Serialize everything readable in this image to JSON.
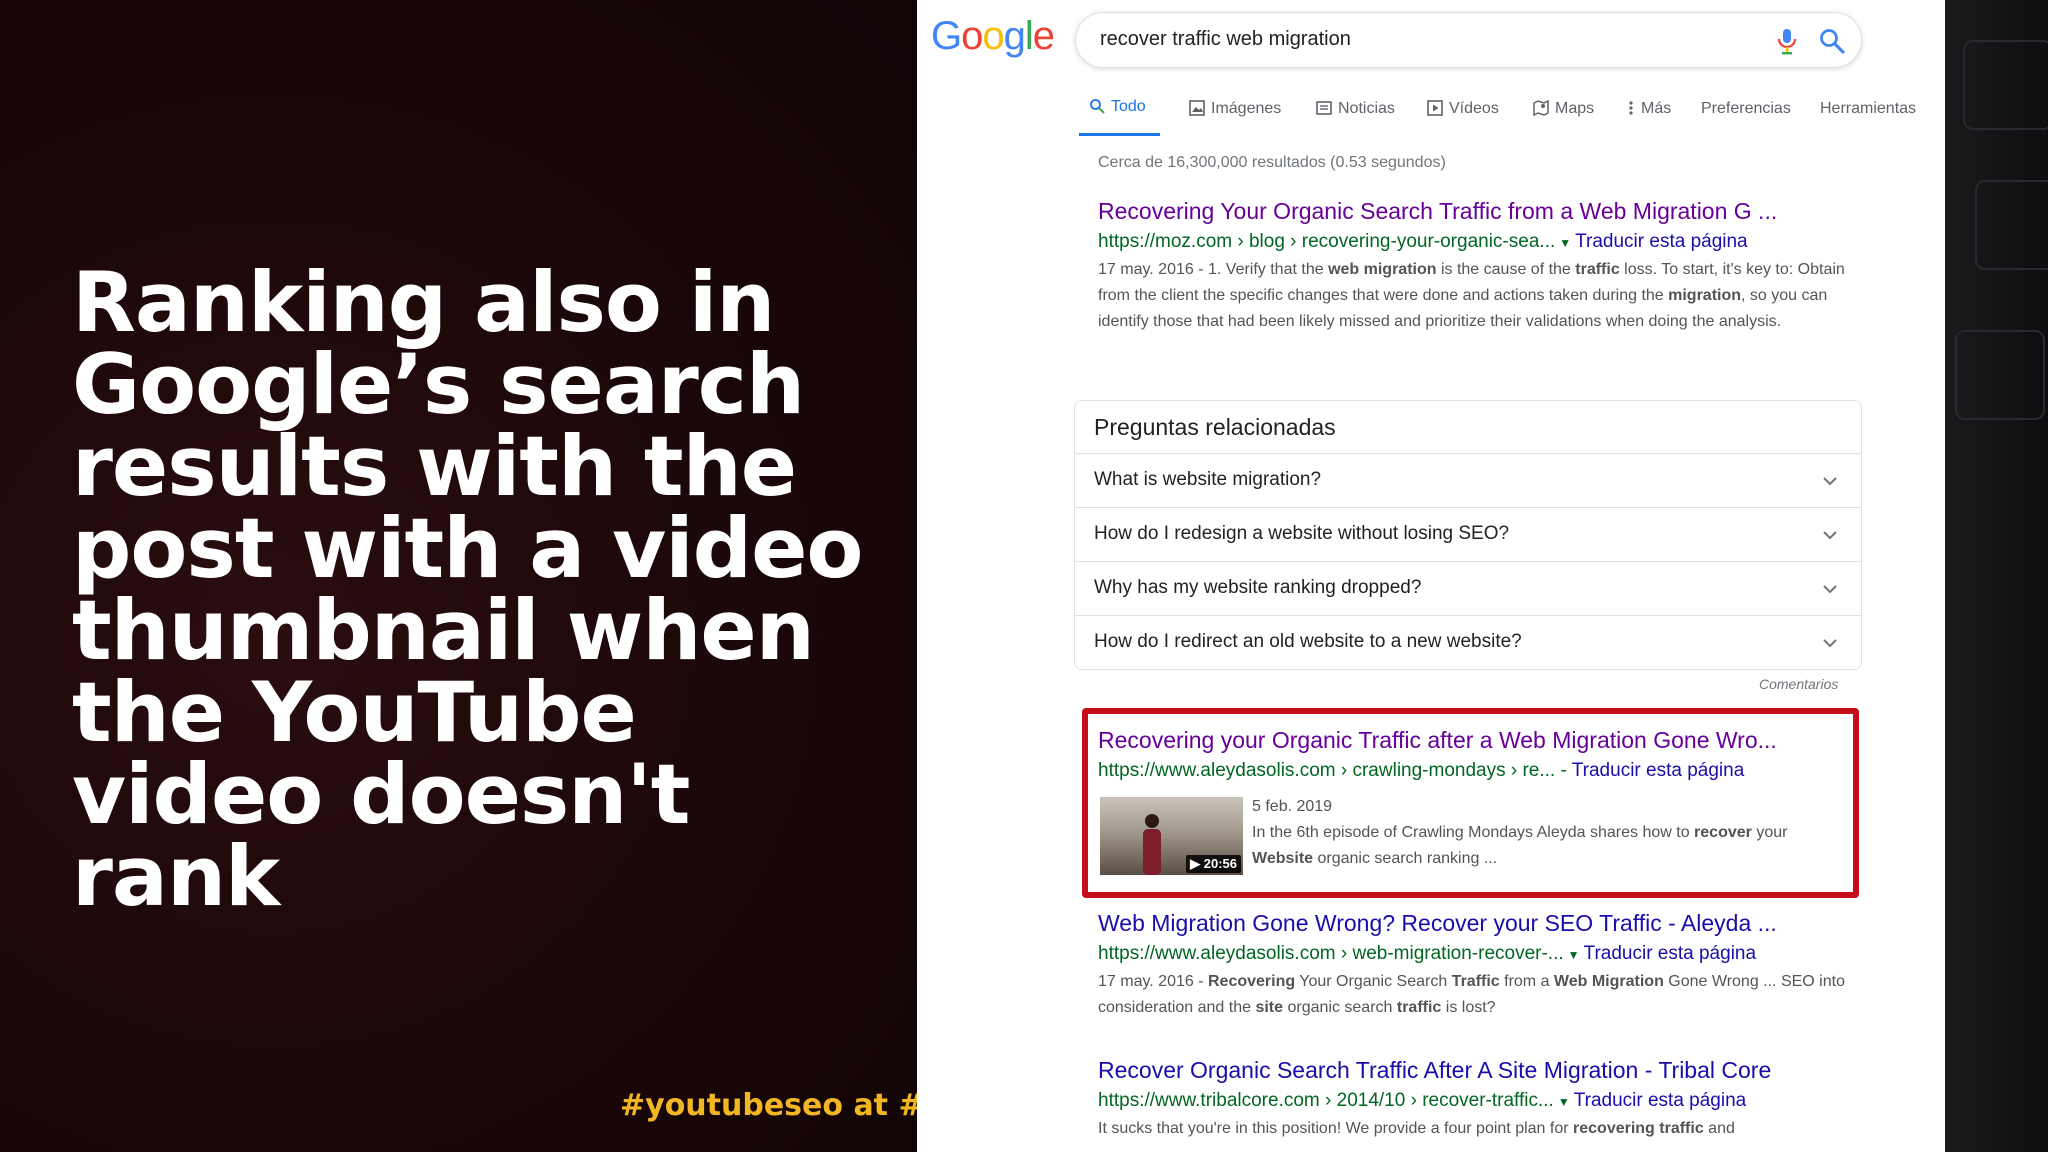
{
  "slide": {
    "headline": "Ranking also in Google’s search results with the post with a video thumbnail when the YouTube video doesn't rank",
    "hashtag": "#youtubeseo at #smx"
  },
  "google": {
    "logo": "Google",
    "colors": {
      "blue": "#4285F4",
      "red": "#EA4335",
      "yellow": "#FBBC05",
      "green": "#34A853"
    },
    "query": "recover traffic web migration",
    "icons": {
      "mic": "mic-icon",
      "search": "search-icon"
    },
    "tabs": [
      {
        "label": "Todo",
        "icon": "search-icon",
        "active": true
      },
      {
        "label": "Imágenes",
        "icon": "image-icon"
      },
      {
        "label": "Noticias",
        "icon": "news-icon"
      },
      {
        "label": "Vídeos",
        "icon": "video-icon"
      },
      {
        "label": "Maps",
        "icon": "map-icon"
      },
      {
        "label": "Más",
        "icon": "more-vert-icon"
      },
      {
        "label": "Preferencias"
      },
      {
        "label": "Herramientas"
      }
    ],
    "stats": "Cerca de 16,300,000 resultados (0.53 segundos)",
    "results": [
      {
        "title": "Recovering Your Organic Search Traffic from a Web Migration G ...",
        "url": "https://moz.com › blog › recovering-your-organic-sea...",
        "translate": "Traducir esta página",
        "date": "17 may. 2016",
        "snippet_parts": [
          "1. Verify that the ",
          "web migration",
          " is the cause of the ",
          "traffic",
          " loss. To start, it's key to: Obtain from the client the specific changes that were done and actions taken during the ",
          "migration",
          ", so you can identify those that had been likely missed and prioritize their validations when doing the analysis."
        ]
      },
      {
        "title": "Recovering your Organic Traffic after a Web Migration Gone Wro...",
        "url": "https://www.aleydasolis.com › crawling-mondays › re...",
        "translate": "Traducir esta página",
        "date": "5 feb. 2019",
        "duration": "20:56",
        "snippet_parts": [
          "In the 6th episode of Crawling Mondays Aleyda shares how to ",
          "recover",
          " your ",
          "Website",
          " organic search ranking ..."
        ]
      },
      {
        "title": "Web Migration Gone Wrong? Recover your SEO Traffic - Aleyda ...",
        "url": "https://www.aleydasolis.com › web-migration-recover-...",
        "translate": "Traducir esta página",
        "date": "17 may. 2016",
        "snippet_parts": [
          "Recovering",
          " Your Organic Search ",
          "Traffic",
          " from a ",
          "Web Migration",
          " Gone Wrong ... SEO into consideration and the ",
          "site",
          " organic search ",
          "traffic",
          " is lost?"
        ]
      },
      {
        "title": "Recover Organic Search Traffic After A Site Migration - Tribal Core",
        "url": "https://www.tribalcore.com › 2014/10 › recover-traffic...",
        "translate": "Traducir esta página",
        "snippet_parts": [
          "It sucks that you're in this position! We provide a four point plan for ",
          "recovering traffic",
          " and"
        ]
      }
    ],
    "paa": {
      "title": "Preguntas relacionadas",
      "questions": [
        "What is website migration?",
        "How do I redesign a website without losing SEO?",
        "Why has my website ranking dropped?",
        "How do I redirect an old website to a new website?"
      ],
      "feedback": "Comentarios"
    }
  }
}
